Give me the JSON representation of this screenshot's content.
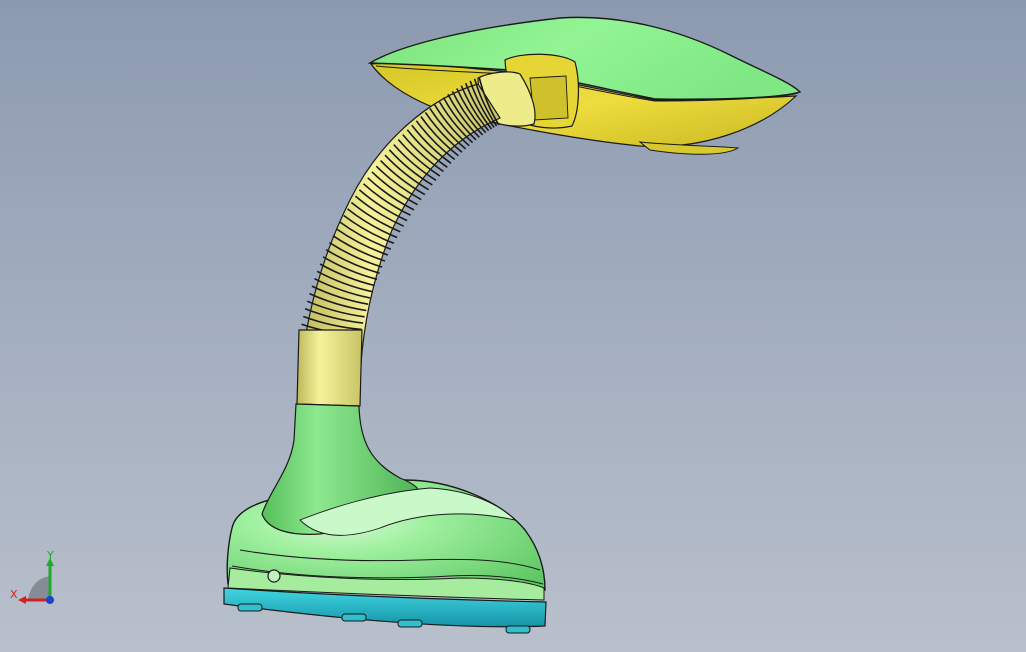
{
  "viewport": {
    "background_top": "#8c9ab0",
    "background_bottom": "#b9c0cc"
  },
  "model": {
    "colors": {
      "shade_green": "#8ef08e",
      "shade_green_dark": "#5fcf64",
      "inner_yellow": "#e8d83a",
      "hose_yellow": "#eeec8a",
      "base_rim_cyan": "#1fb5c7",
      "edge": "#1a1a1a"
    }
  },
  "triad": {
    "x_label": "X",
    "y_label": "Y",
    "x_color": "#d42020",
    "y_color": "#1fa82c",
    "z_color": "#2040d0"
  }
}
